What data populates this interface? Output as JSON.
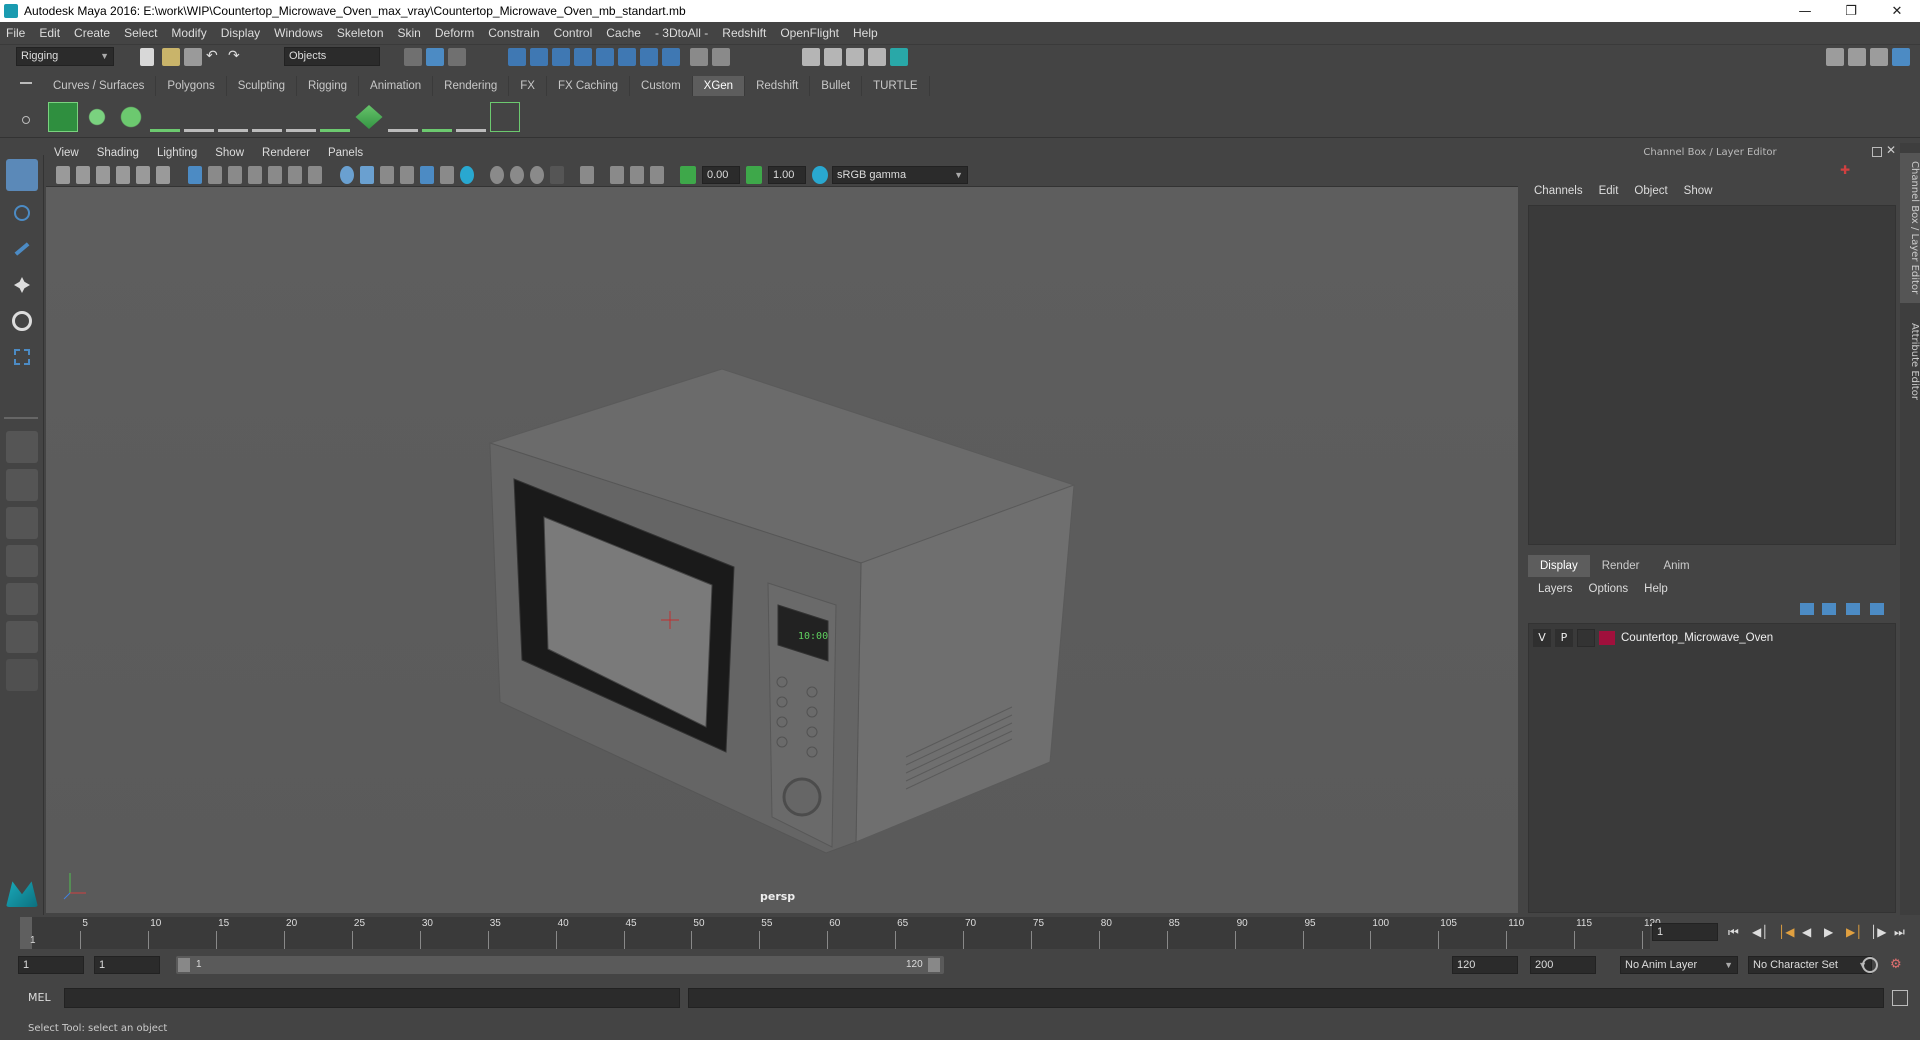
{
  "window": {
    "title": "Autodesk Maya 2016: E:\\work\\WIP\\Countertop_Microwave_Oven_max_vray\\Countertop_Microwave_Oven_mb_standart.mb"
  },
  "menubar": [
    "File",
    "Edit",
    "Create",
    "Select",
    "Modify",
    "Display",
    "Windows",
    "Skeleton",
    "Skin",
    "Deform",
    "Constrain",
    "Control",
    "Cache",
    "- 3DtoAll -",
    "Redshift",
    "OpenFlight",
    "Help"
  ],
  "statusline": {
    "mode": "Rigging",
    "selection_mode": "Objects"
  },
  "shelf_tabs": [
    "Curves / Surfaces",
    "Polygons",
    "Sculpting",
    "Rigging",
    "Animation",
    "Rendering",
    "FX",
    "FX Caching",
    "Custom",
    "XGen",
    "Redshift",
    "Bullet",
    "TURTLE"
  ],
  "shelf_active": "XGen",
  "viewport": {
    "menu": [
      "View",
      "Shading",
      "Lighting",
      "Show",
      "Renderer",
      "Panels"
    ],
    "exposure": "0.00",
    "gamma": "1.00",
    "color_space": "sRGB gamma",
    "camera_label": "persp",
    "display_text": "10:00"
  },
  "right_panel": {
    "header": "Channel Box / Layer Editor",
    "menu": [
      "Channels",
      "Edit",
      "Object",
      "Show"
    ],
    "layer_tabs": [
      "Display",
      "Render",
      "Anim"
    ],
    "layer_tab_active": "Display",
    "layer_menu": [
      "Layers",
      "Options",
      "Help"
    ],
    "layers": [
      {
        "v": "V",
        "p": "P",
        "name": "Countertop_Microwave_Oven",
        "color": "#a0103c"
      }
    ],
    "side_tabs": [
      "Channel Box / Layer Editor",
      "Attribute Editor"
    ]
  },
  "timeslider": {
    "ticks": [
      "5",
      "10",
      "15",
      "20",
      "25",
      "30",
      "35",
      "40",
      "45",
      "50",
      "55",
      "60",
      "65",
      "70",
      "75",
      "80",
      "85",
      "90",
      "95",
      "100",
      "105",
      "110",
      "115",
      "120"
    ],
    "first": "1",
    "current_frame": "1"
  },
  "rangebar": {
    "start": "1",
    "playback_start": "1",
    "range_start_label": "1",
    "range_end_label": "120",
    "playback_end": "120",
    "end": "200",
    "anim_layer": "No Anim Layer",
    "character_set": "No Character Set"
  },
  "cmdline": {
    "label": "MEL"
  },
  "helpline": {
    "text": "Select Tool: select an object"
  }
}
